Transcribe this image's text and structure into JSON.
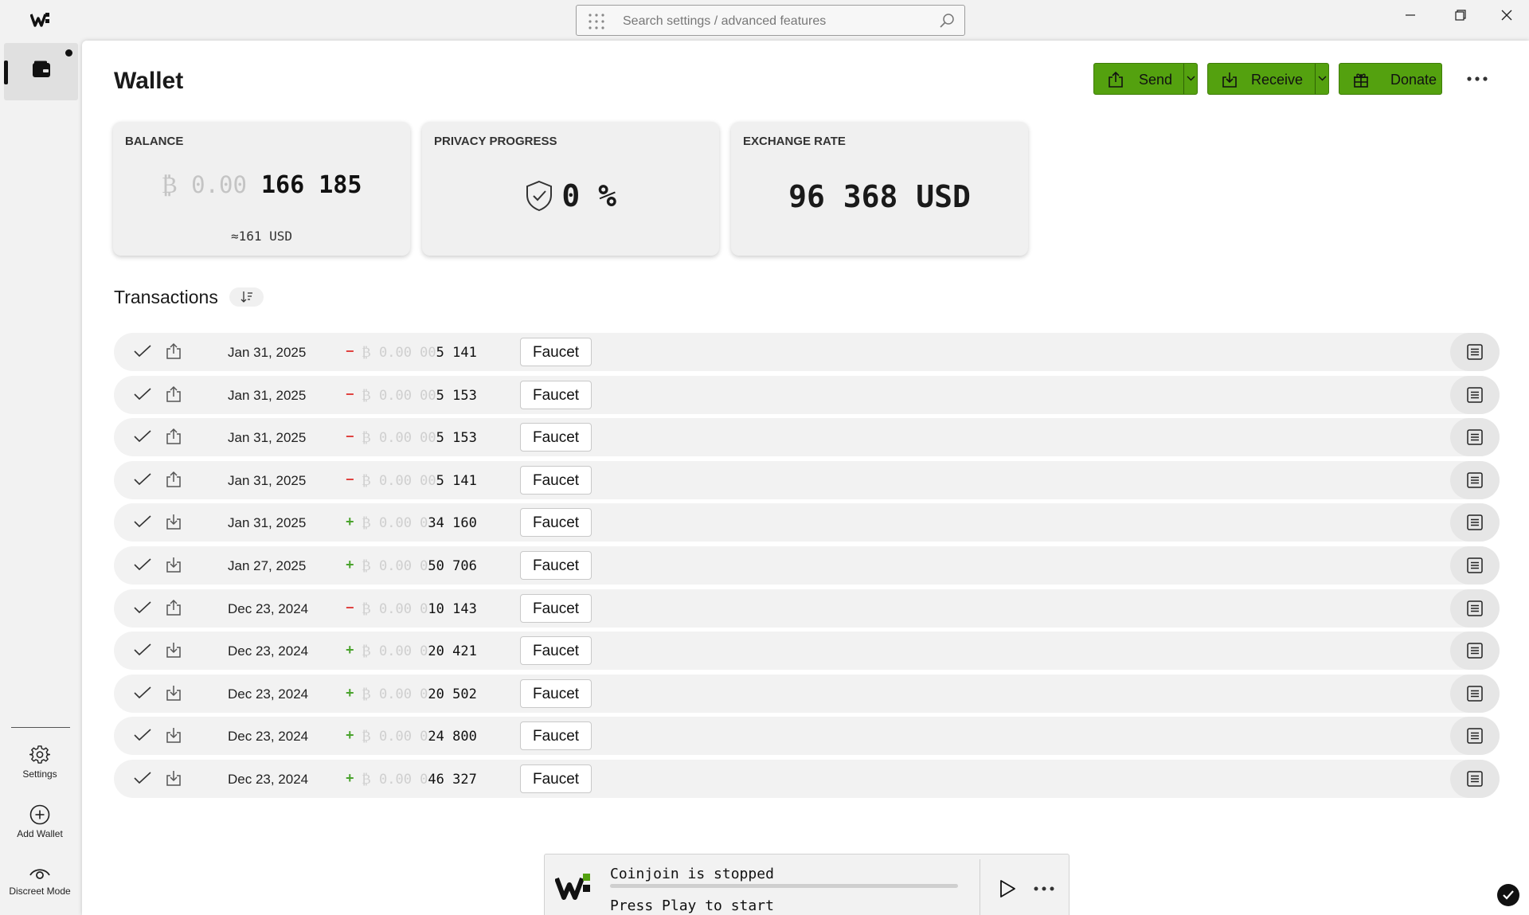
{
  "search": {
    "placeholder": "Search settings / advanced features"
  },
  "sidebar": {
    "settings_label": "Settings",
    "add_wallet_label": "Add Wallet",
    "discreet_label": "Discreet Mode"
  },
  "header": {
    "title": "Wallet",
    "send_label": "Send",
    "receive_label": "Receive",
    "donate_label": "Donate"
  },
  "cards": {
    "balance": {
      "caption": "BALANCE",
      "prefix": "₿ 0.00",
      "value": "166 185",
      "usd": "≈161 USD"
    },
    "privacy": {
      "caption": "PRIVACY PROGRESS",
      "value": "0 %"
    },
    "rate": {
      "caption": "EXCHANGE RATE",
      "value": "96 368 USD"
    }
  },
  "transactions": {
    "title": "Transactions",
    "rows": [
      {
        "direction": "out",
        "date": "Jan 31, 2025",
        "sign": "−",
        "prefix": "₿ 0.00 00",
        "amount": "5 141",
        "label": "Faucet"
      },
      {
        "direction": "out",
        "date": "Jan 31, 2025",
        "sign": "−",
        "prefix": "₿ 0.00 00",
        "amount": "5 153",
        "label": "Faucet"
      },
      {
        "direction": "out",
        "date": "Jan 31, 2025",
        "sign": "−",
        "prefix": "₿ 0.00 00",
        "amount": "5 153",
        "label": "Faucet"
      },
      {
        "direction": "out",
        "date": "Jan 31, 2025",
        "sign": "−",
        "prefix": "₿ 0.00 00",
        "amount": "5 141",
        "label": "Faucet"
      },
      {
        "direction": "in",
        "date": "Jan 31, 2025",
        "sign": "+",
        "prefix": "₿ 0.00 0",
        "amount": "34 160",
        "label": "Faucet"
      },
      {
        "direction": "in",
        "date": "Jan 27, 2025",
        "sign": "+",
        "prefix": "₿ 0.00 0",
        "amount": "50 706",
        "label": "Faucet"
      },
      {
        "direction": "out",
        "date": "Dec 23, 2024",
        "sign": "−",
        "prefix": "₿ 0.00 0",
        "amount": "10 143",
        "label": "Faucet"
      },
      {
        "direction": "in",
        "date": "Dec 23, 2024",
        "sign": "+",
        "prefix": "₿ 0.00 0",
        "amount": "20 421",
        "label": "Faucet"
      },
      {
        "direction": "in",
        "date": "Dec 23, 2024",
        "sign": "+",
        "prefix": "₿ 0.00 0",
        "amount": "20 502",
        "label": "Faucet"
      },
      {
        "direction": "in",
        "date": "Dec 23, 2024",
        "sign": "+",
        "prefix": "₿ 0.00 0",
        "amount": "24 800",
        "label": "Faucet"
      },
      {
        "direction": "in",
        "date": "Dec 23, 2024",
        "sign": "+",
        "prefix": "₿ 0.00 0",
        "amount": "46 327",
        "label": "Faucet"
      }
    ]
  },
  "coinjoin": {
    "status": "Coinjoin is stopped",
    "hint": "Press Play to start",
    "progress": 0
  },
  "colors": {
    "accent_green": "#54a10f",
    "negative": "#e0413e",
    "positive": "#4aa32d"
  }
}
